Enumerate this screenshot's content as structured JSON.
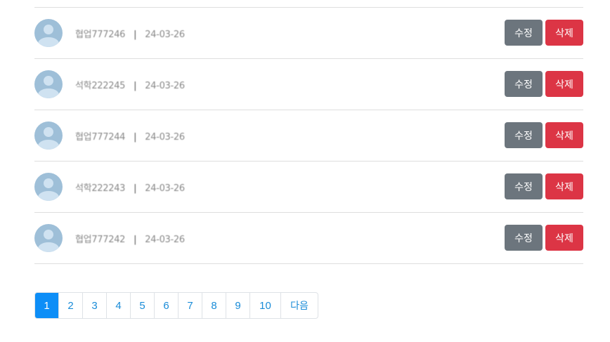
{
  "comments": [
    {
      "author": "협업777246",
      "date": "24-03-26",
      "edit_label": "수정",
      "delete_label": "삭제"
    },
    {
      "author": "석학222245",
      "date": "24-03-26",
      "edit_label": "수정",
      "delete_label": "삭제"
    },
    {
      "author": "협업777244",
      "date": "24-03-26",
      "edit_label": "수정",
      "delete_label": "삭제"
    },
    {
      "author": "석학222243",
      "date": "24-03-26",
      "edit_label": "수정",
      "delete_label": "삭제"
    },
    {
      "author": "협업777242",
      "date": "24-03-26",
      "edit_label": "수정",
      "delete_label": "삭제"
    }
  ],
  "separator": "|",
  "pagination": {
    "pages": [
      "1",
      "2",
      "3",
      "4",
      "5",
      "6",
      "7",
      "8",
      "9",
      "10"
    ],
    "active_page": "1",
    "next_label": "다음"
  },
  "colors": {
    "edit_button": "#6c757d",
    "delete_button": "#dc3545",
    "active_page": "#0d8ef7",
    "link": "#1a8cd8"
  }
}
